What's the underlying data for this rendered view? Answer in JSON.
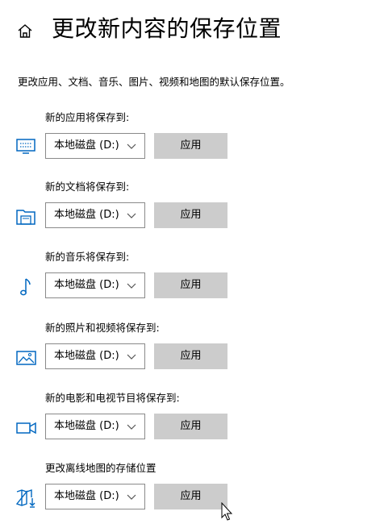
{
  "page": {
    "title": "更改新内容的保存位置",
    "description": "更改应用、文档、音乐、图片、视频和地图的默认保存位置。"
  },
  "sections": [
    {
      "label": "新的应用将保存到:",
      "icon": "monitor-icon",
      "drive": "本地磁盘 (D:)",
      "apply_label": "应用"
    },
    {
      "label": "新的文档将保存到:",
      "icon": "documents-folder-icon",
      "drive": "本地磁盘 (D:)",
      "apply_label": "应用"
    },
    {
      "label": "新的音乐将保存到:",
      "icon": "music-note-icon",
      "drive": "本地磁盘 (D:)",
      "apply_label": "应用"
    },
    {
      "label": "新的照片和视频将保存到:",
      "icon": "picture-icon",
      "drive": "本地磁盘 (D:)",
      "apply_label": "应用"
    },
    {
      "label": "新的电影和电视节目将保存到:",
      "icon": "video-camera-icon",
      "drive": "本地磁盘 (D:)",
      "apply_label": "应用"
    },
    {
      "label": "更改离线地图的存储位置",
      "icon": "map-download-icon",
      "drive": "本地磁盘 (D:)",
      "apply_label": "应用"
    }
  ],
  "colors": {
    "icon_blue": "#0067c0",
    "button_bg": "#cccccc",
    "border": "#8a8a8a"
  }
}
